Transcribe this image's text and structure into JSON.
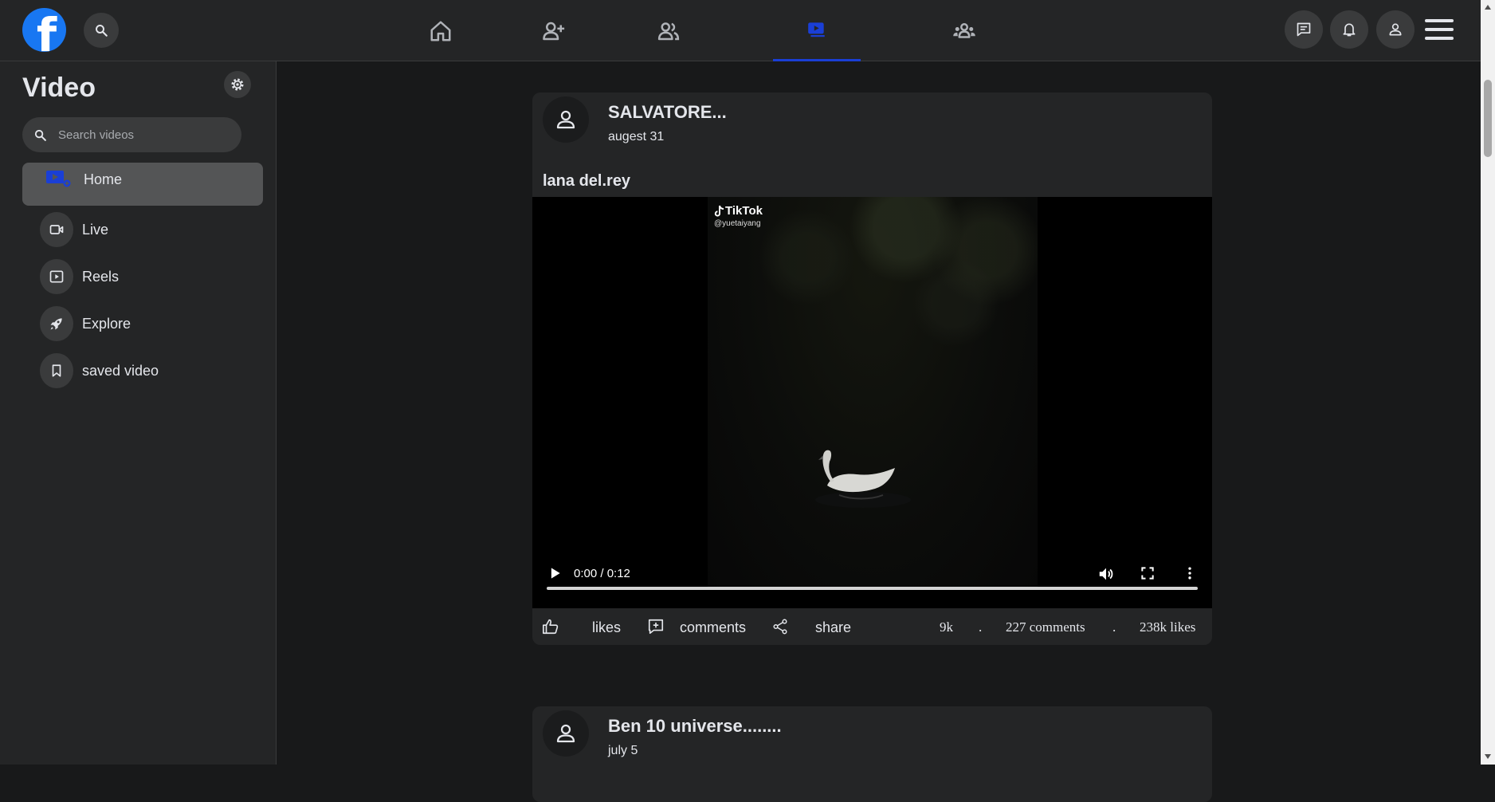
{
  "header": {
    "logo_letter": "f",
    "icons": {
      "search": "search-icon",
      "home": "home-icon",
      "friend_requests": "add-friend-icon",
      "friends": "friends-icon",
      "video": "video-icon",
      "groups": "groups-icon",
      "messenger": "messenger-icon",
      "notifications": "bell-icon",
      "profile": "profile-icon",
      "menu": "hamburger-menu-icon"
    },
    "active_tab": "video",
    "accent_color": "#1a3fd6"
  },
  "sidebar": {
    "title": "Video",
    "search_placeholder": "Search videos",
    "items": [
      {
        "label": "Home",
        "icon": "video-play-icon",
        "active": true
      },
      {
        "label": "Live",
        "icon": "live-camera-icon"
      },
      {
        "label": "Reels",
        "icon": "reels-icon"
      },
      {
        "label": "Explore",
        "icon": "rocket-icon"
      },
      {
        "label": "saved video",
        "icon": "bookmark-icon"
      }
    ]
  },
  "posts": [
    {
      "author": "SALVATORE...",
      "date": "augest 31",
      "caption": "lana del.rey",
      "video": {
        "watermark_brand": "TikTok",
        "watermark_handle": "@yuetaiyang",
        "time": "0:00 / 0:12",
        "progress": 0
      },
      "actions": {
        "likes_label": "likes",
        "comments_label": "comments",
        "share_label": "share"
      },
      "stats": {
        "shares": "9k",
        "separator": ".",
        "comments": "227 comments",
        "likes": "238k likes"
      }
    },
    {
      "author": "Ben 10 universe........",
      "date": "july 5"
    }
  ]
}
